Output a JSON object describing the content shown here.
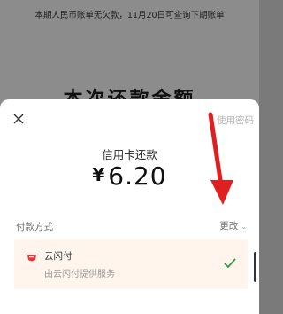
{
  "background": {
    "notice": "本期人民币账单无欠款，11月20日可查询下期账单",
    "title": "本次还款金额"
  },
  "sheet": {
    "close_icon": "close-icon",
    "use_password": "使用密码",
    "payment_label": "信用卡还款",
    "currency_symbol": "¥",
    "amount": "6.20",
    "method_label": "付款方式",
    "change_label": "更改",
    "selected_method": {
      "name": "云闪付",
      "description": "由云闪付提供服务",
      "icon": "unionpay-logo-icon",
      "selected": true
    }
  },
  "colors": {
    "overlay": "#8c8c8c",
    "option_bg": "#fff5ec",
    "check": "#2e9b45",
    "annotation_arrow": "#e02020",
    "logo": "#e23a3a"
  }
}
